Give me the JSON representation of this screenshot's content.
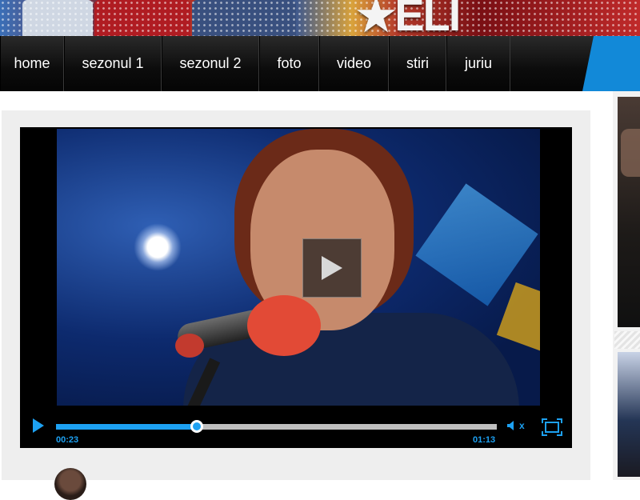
{
  "header": {
    "logo_text": "★ELI"
  },
  "nav": {
    "items": [
      {
        "label": "home"
      },
      {
        "label": "sezonul 1"
      },
      {
        "label": "sezonul 2"
      },
      {
        "label": "foto"
      },
      {
        "label": "video"
      },
      {
        "label": "stiri"
      },
      {
        "label": "juriu"
      }
    ]
  },
  "player": {
    "current_time": "00:23",
    "duration": "01:13",
    "progress_fraction": 0.32,
    "mute_label": "x",
    "accent_color": "#1da1f2",
    "icons": {
      "play": "play-icon",
      "overlay_play": "big-play-icon",
      "mute": "speaker-muted-icon",
      "fullscreen": "fullscreen-icon"
    }
  },
  "colors": {
    "nav_bg": "#0c0c0c",
    "nav_accent": "#1289d8",
    "player_accent": "#1da1f2"
  }
}
